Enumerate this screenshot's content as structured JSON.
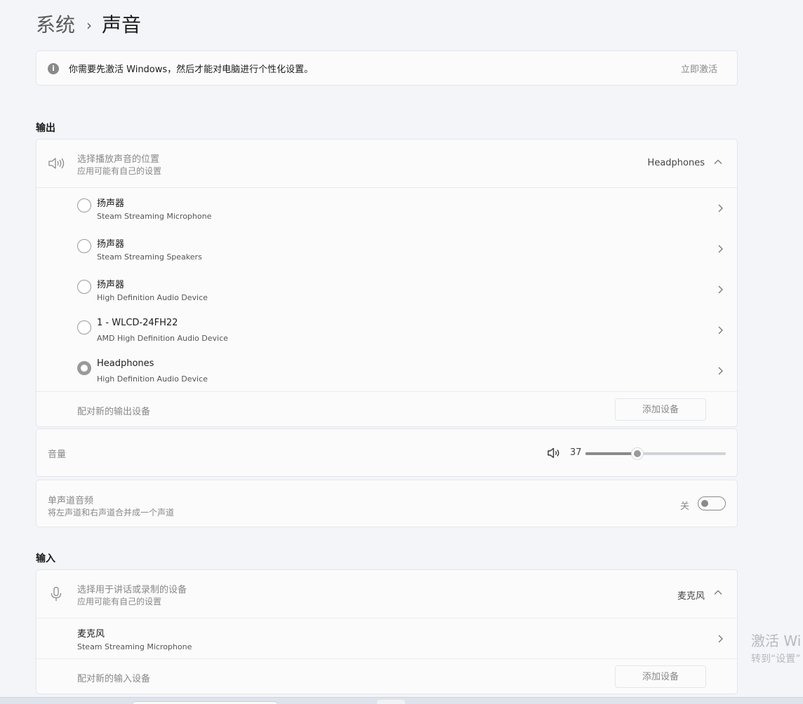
{
  "breadcrumb": {
    "parent": "系统",
    "separator": "›",
    "current": "声音"
  },
  "activation": {
    "info_icon": "info-icon",
    "message": "你需要先激活 Windows，然后才能对电脑进行个性化设置。",
    "button": "立即激活"
  },
  "output": {
    "section_title": "输出",
    "header": {
      "icon": "speaker-icon",
      "title": "选择播放声音的位置",
      "subtitle": "应用可能有自己的设置",
      "value": "Headphones"
    },
    "devices": [
      {
        "name": "扬声器",
        "desc": "Steam Streaming Microphone",
        "selected": false
      },
      {
        "name": "扬声器",
        "desc": "Steam Streaming Speakers",
        "selected": false
      },
      {
        "name": "扬声器",
        "desc": "High Definition Audio Device",
        "selected": false
      },
      {
        "name": "1 - WLCD-24FH22",
        "desc": "AMD High Definition Audio Device",
        "selected": false
      },
      {
        "name": "Headphones",
        "desc": "High Definition Audio Device",
        "selected": true
      }
    ],
    "pair_label": "配对新的输出设备",
    "add_button": "添加设备"
  },
  "volume": {
    "label": "音量",
    "value": "37",
    "level": 37,
    "icon": "volume-icon"
  },
  "mono": {
    "title": "单声道音频",
    "subtitle": "将左声道和右声道合并成一个声道",
    "state": "关",
    "on": false
  },
  "input": {
    "section_title": "输入",
    "header": {
      "icon": "microphone-icon",
      "title": "选择用于讲话或录制的设备",
      "subtitle": "应用可能有自己的设置",
      "value": "麦克风"
    },
    "devices": [
      {
        "name": "麦克风",
        "desc": "Steam Streaming Microphone"
      }
    ],
    "pair_label": "配对新的输入设备",
    "add_button": "添加设备"
  },
  "watermark": {
    "line1": "激活 Wi",
    "line2": "转到“设置”"
  },
  "colors": {
    "accent": "#8a8a8a",
    "background": "#f3f5f9",
    "card": "#fbfbfc"
  }
}
